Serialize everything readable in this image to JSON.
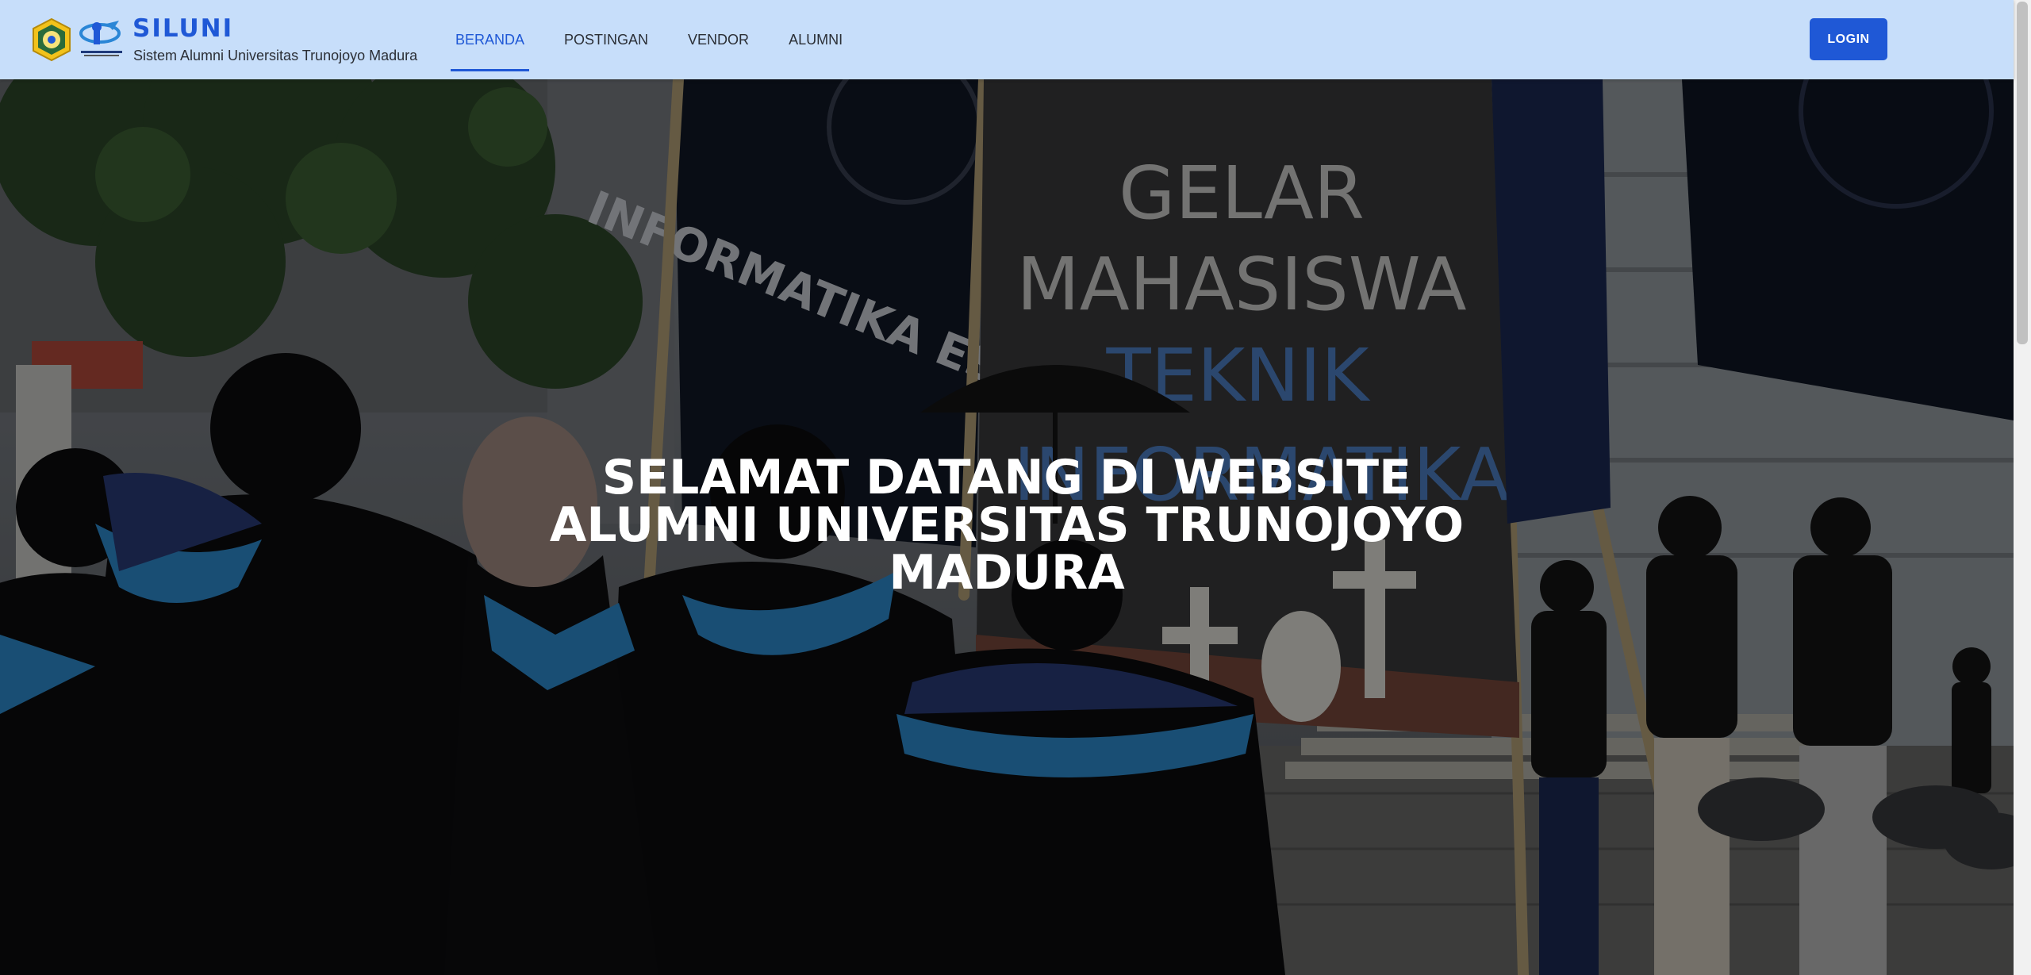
{
  "brand": {
    "title": "SILUNI",
    "subtitle": "Sistem Alumni Universitas Trunojoyo Madura",
    "university_logo_icon": "university-seal-icon",
    "department_logo_icon": "informatics-logo-icon"
  },
  "nav": {
    "items": [
      {
        "label": "BERANDA",
        "active": true
      },
      {
        "label": "POSTINGAN",
        "active": false
      },
      {
        "label": "VENDOR",
        "active": false
      },
      {
        "label": "ALUMNI",
        "active": false
      }
    ]
  },
  "header": {
    "login_label": "LOGIN"
  },
  "hero": {
    "title_lines": [
      "SELAMAT DATANG DI WEBSITE",
      "ALUMNI UNIVERSITAS TRUNOJOYO",
      "MADURA"
    ],
    "banner_text": [
      "GELAR",
      "MAHASISWA",
      "TEKNIK",
      "INFORMATIKA"
    ],
    "flag_text": "INFORMATIKA EST 2"
  },
  "colors": {
    "header_bg": "#c7defa",
    "primary": "#1f58d6",
    "hero_overlay": "rgba(0,0,0,0.45)"
  }
}
